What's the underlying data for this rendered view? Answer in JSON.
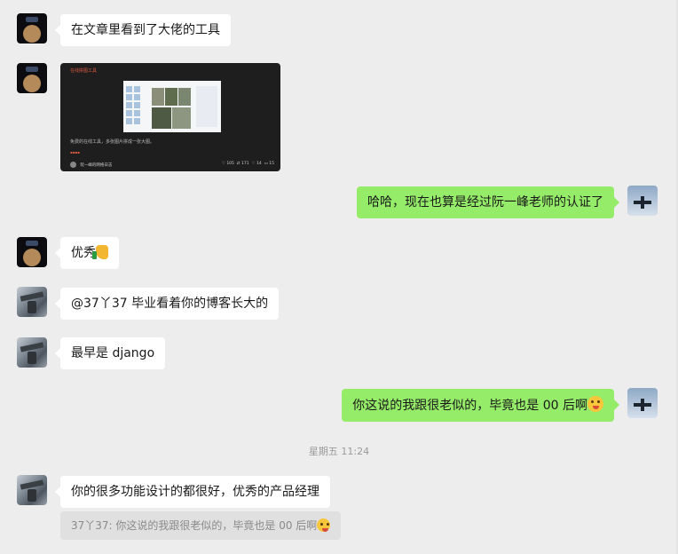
{
  "messages": [
    {
      "side": "left",
      "text": "在文章里看到了大佬的工具"
    },
    {
      "side": "left",
      "type": "image-card",
      "card": {
        "title": "在线拼图工具",
        "desc": "免费的在线工具，多张图片拼成一张大图。",
        "author": "阮一峰的网络日志",
        "likes": "105",
        "shares": "171",
        "favs": "14",
        "comments": "15"
      }
    },
    {
      "side": "right",
      "text": "哈哈，现在也算是经过阮一峰老师的认证了"
    },
    {
      "side": "left",
      "text": "优秀",
      "emoji": "thumbs-up"
    },
    {
      "side": "left",
      "text": "@37丫37 毕业看着你的博客长大的"
    },
    {
      "side": "left",
      "text": "最早是 django"
    },
    {
      "side": "right",
      "text": "你这说的我跟很老似的，毕竟也是 00 后啊",
      "emoji": "face"
    }
  ],
  "timestamp": "星期五 11:24",
  "last_message": {
    "text": "你的很多功能设计的都很好，优秀的产品经理"
  },
  "quote": {
    "text": "37丫37: 你这说的我跟很老似的，毕竟也是 00 后啊"
  },
  "colors": {
    "background": "#ededed",
    "me_bubble": "#95ec69",
    "other_bubble": "#ffffff"
  }
}
